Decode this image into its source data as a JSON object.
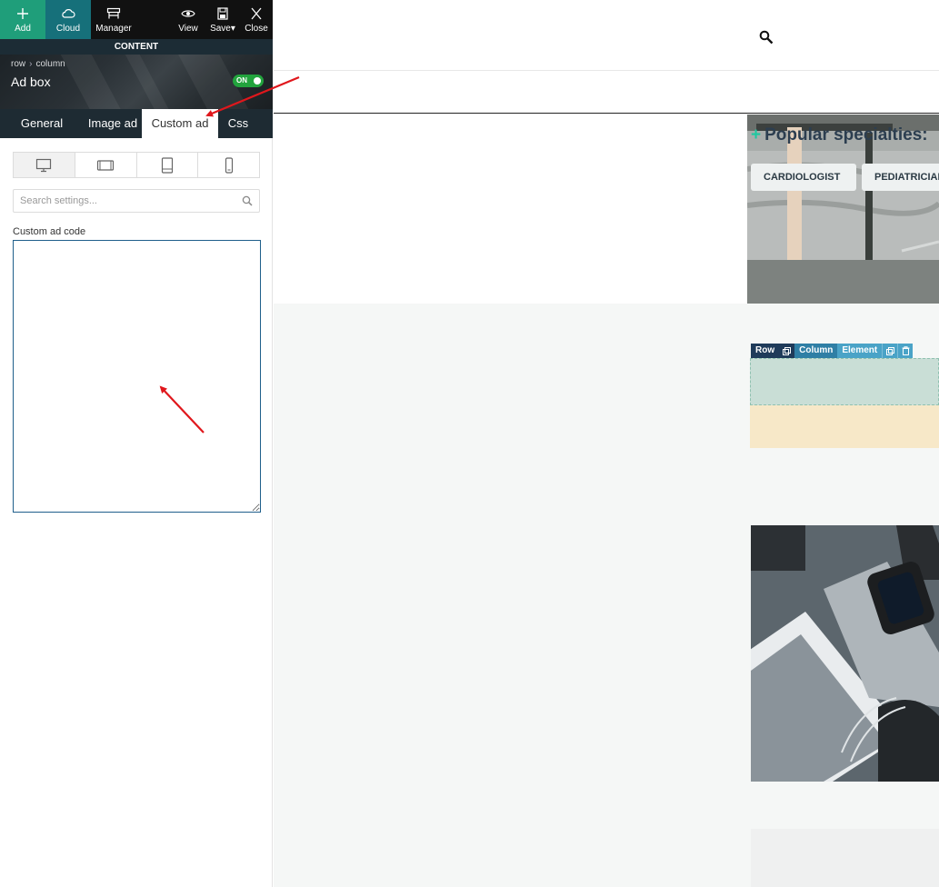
{
  "toolbar": {
    "add_label": "Add",
    "cloud_label": "Cloud",
    "manager_label": "Manager",
    "view_label": "View",
    "save_label": "Save",
    "close_label": "Close"
  },
  "content_bar": {
    "label": "CONTENT"
  },
  "panel": {
    "breadcrumb": [
      "row",
      "column"
    ],
    "title": "Ad box",
    "toggle_label": "ON",
    "tabs": [
      {
        "label": "General"
      },
      {
        "label": "Image ad"
      },
      {
        "label": "Custom ad"
      },
      {
        "label": "Css"
      }
    ],
    "active_tab": "Custom ad",
    "devices": [
      "desktop-icon",
      "tablet-landscape-icon",
      "tablet-portrait-icon",
      "mobile-icon"
    ],
    "search_placeholder": "Search settings...",
    "custom_ad_label": "Custom ad code",
    "custom_ad_value": ""
  },
  "preview": {
    "specialties_title": "Popular specialties:",
    "specialties": [
      "CARDIOLOGIST",
      "PEDIATRICIAN"
    ],
    "element_toolbar": {
      "row": "Row",
      "column": "Column",
      "element": "Element"
    },
    "colors": {
      "accent_green": "#1ec8a0",
      "editor_green": "#1f9e7a",
      "editor_teal": "#16707a",
      "element_dark": "#1f3b5a",
      "element_mid": "#2f7fa5",
      "element_light": "#4aa3c7",
      "highlight_green": "#c9ded6",
      "highlight_beige": "#f7e8c8",
      "annotation_red": "#e0171c"
    }
  }
}
